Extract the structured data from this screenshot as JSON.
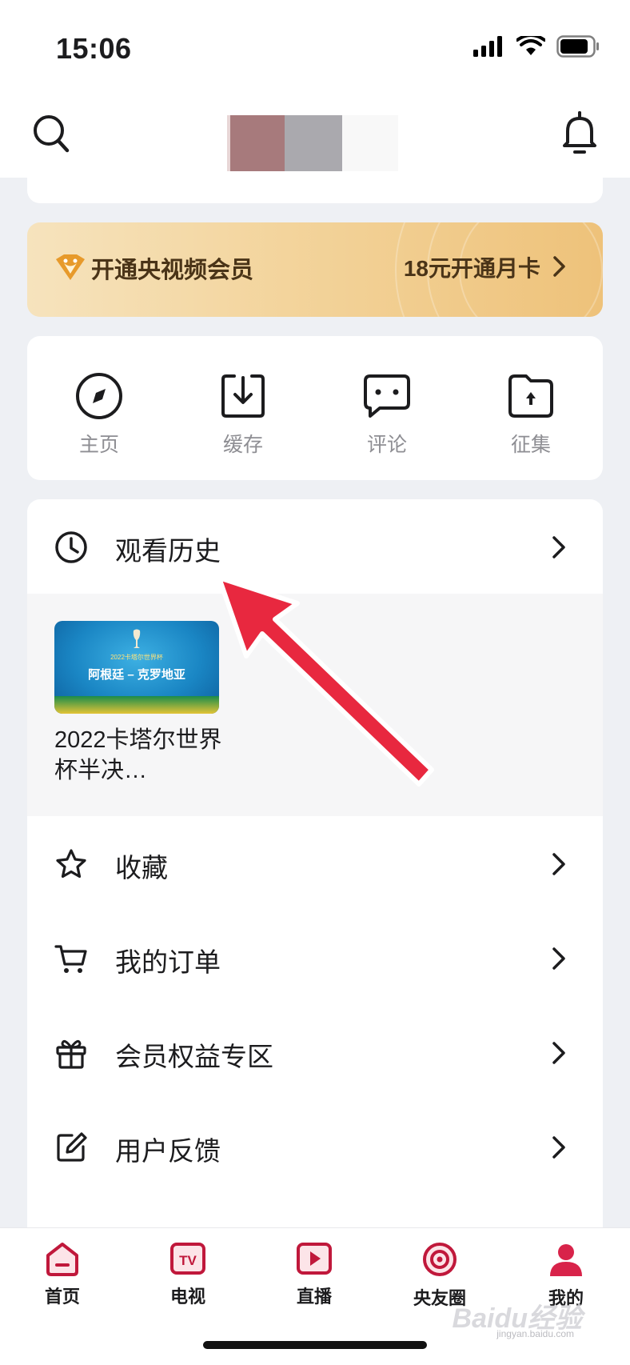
{
  "status_bar": {
    "time": "15:06"
  },
  "header": {
    "search_icon": "search-icon",
    "bell_icon": "bell-icon"
  },
  "vip_banner": {
    "title": "开通央视频会员",
    "offer": "18元开通月卡",
    "colors": {
      "start": "#f6e3bd",
      "end": "#eec27a",
      "text": "#4a3418"
    }
  },
  "quick_actions": [
    {
      "label": "主页",
      "icon": "compass-icon"
    },
    {
      "label": "缓存",
      "icon": "download-icon"
    },
    {
      "label": "评论",
      "icon": "comment-icon"
    },
    {
      "label": "征集",
      "icon": "folder-upload-icon"
    }
  ],
  "history": {
    "label": "观看历史",
    "items": [
      {
        "title": "2022卡塔尔世界杯半决…",
        "thumb_title": "阿根廷 – 克罗地亚",
        "thumb_sub": "2022卡塔尔世界杯"
      }
    ]
  },
  "menu": [
    {
      "label": "收藏",
      "icon": "star-icon"
    },
    {
      "label": "我的订单",
      "icon": "cart-icon"
    },
    {
      "label": "会员权益专区",
      "icon": "gift-icon"
    },
    {
      "label": "用户反馈",
      "icon": "edit-icon"
    }
  ],
  "tabbar": [
    {
      "label": "首页",
      "icon": "home-icon"
    },
    {
      "label": "电视",
      "icon": "tv-icon"
    },
    {
      "label": "直播",
      "icon": "live-icon"
    },
    {
      "label": "央友圈",
      "icon": "circle-icon"
    },
    {
      "label": "我的",
      "icon": "profile-icon"
    }
  ],
  "accent_color": "#c0183b",
  "watermark": {
    "text": "Baidu经验",
    "sub": "jingyan.baidu.com"
  }
}
